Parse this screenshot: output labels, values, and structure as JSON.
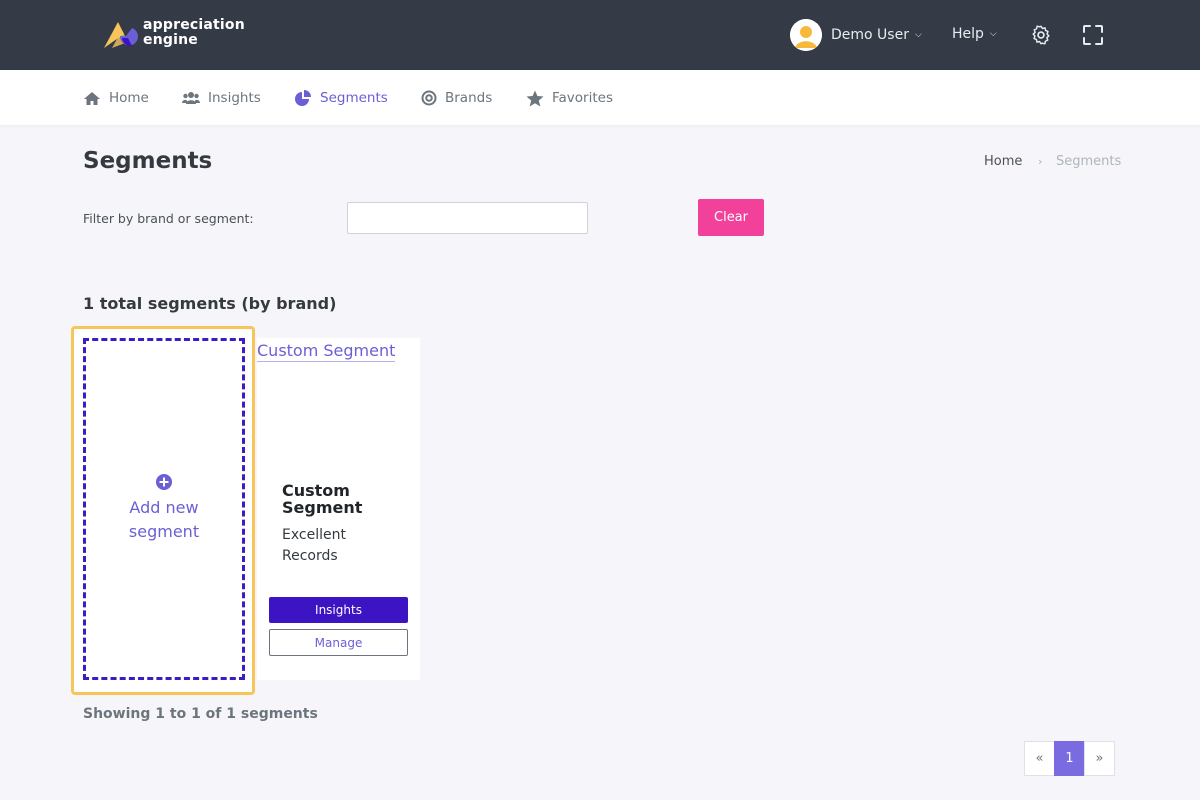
{
  "brand": {
    "name": "appreciation engine",
    "line1": "appreciation",
    "line2": "engine"
  },
  "topbar": {
    "user_name": "Demo User",
    "help_label": "Help"
  },
  "nav": {
    "home": "Home",
    "insights": "Insights",
    "segments": "Segments",
    "brands": "Brands",
    "favorites": "Favorites"
  },
  "page": {
    "title": "Segments",
    "breadcrumb": {
      "home": "Home",
      "separator": "›",
      "current": "Segments"
    }
  },
  "filter": {
    "label": "Filter by brand or segment:",
    "value": "",
    "placeholder": "",
    "clear_label": "Clear"
  },
  "summary": {
    "total_text": "1 total segments (by brand)"
  },
  "add_card": {
    "line1": "Add new",
    "line2": "segment"
  },
  "segment_card": {
    "header_link": "Custom Segment",
    "name": "Custom Segment",
    "description": "Excellent Records",
    "insights_label": "Insights",
    "manage_label": "Manage"
  },
  "footer": {
    "showing": "Showing 1 to 1 of 1 segments"
  },
  "pagination": {
    "prev": "«",
    "current": "1",
    "next": "»"
  },
  "colors": {
    "topbar": "#343a46",
    "accent": "#6b5fd6",
    "primary_button": "#3c14c4",
    "clear_button": "#f1419a",
    "highlight_border": "#f6c65b"
  }
}
